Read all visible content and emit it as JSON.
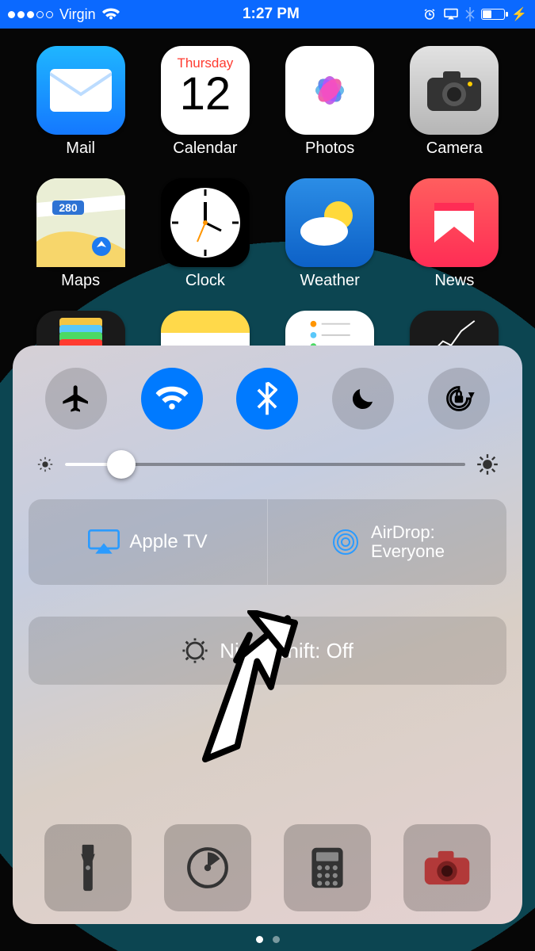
{
  "status_bar": {
    "carrier": "Virgin",
    "signal_strength": 3,
    "signal_total": 5,
    "wifi": true,
    "time": "1:27 PM",
    "alarm": true,
    "airplay": true,
    "bluetooth": true,
    "battery_pct": 40,
    "charging": true
  },
  "home_apps": {
    "row1": [
      {
        "label": "Mail",
        "icon": "mail"
      },
      {
        "label": "Calendar",
        "icon": "calendar",
        "day_name": "Thursday",
        "day_num": "12"
      },
      {
        "label": "Photos",
        "icon": "photos"
      },
      {
        "label": "Camera",
        "icon": "camera"
      }
    ],
    "row2": [
      {
        "label": "Maps",
        "icon": "maps"
      },
      {
        "label": "Clock",
        "icon": "clock"
      },
      {
        "label": "Weather",
        "icon": "weather"
      },
      {
        "label": "News",
        "icon": "news"
      }
    ],
    "row3_partial": [
      {
        "icon": "wallet"
      },
      {
        "icon": "notes"
      },
      {
        "icon": "reminders"
      },
      {
        "icon": "stocks"
      }
    ]
  },
  "control_center": {
    "toggles": {
      "airplane_active": false,
      "wifi_active": true,
      "bluetooth_active": true,
      "dnd_active": false,
      "rotation_lock_active": false
    },
    "brightness_pct": 14,
    "airplay_label": "Apple TV",
    "airdrop_label_line1": "AirDrop:",
    "airdrop_label_line2": "Everyone",
    "night_shift_label": "Night Shift: Off",
    "shortcuts": [
      "flashlight",
      "timer",
      "calculator",
      "camera"
    ]
  },
  "page_indicator": {
    "total": 2,
    "active": 0
  }
}
